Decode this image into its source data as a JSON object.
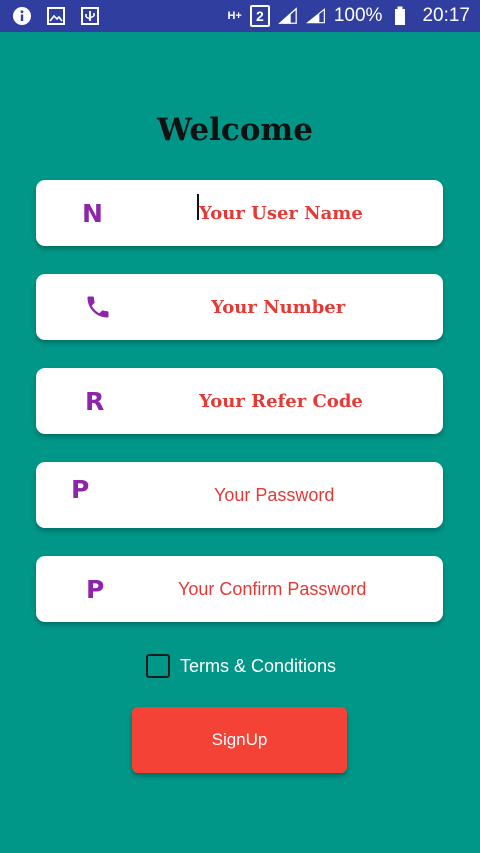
{
  "status_bar": {
    "left_icons": [
      "info-icon",
      "image-icon",
      "usb-icon"
    ],
    "network_type": "H+",
    "sim_slot": "2",
    "signal_icons": [
      "signal-icon",
      "signal-icon"
    ],
    "battery_percent": "100%",
    "battery_icon": "battery-icon",
    "time": "20:17"
  },
  "title": "Welcome",
  "fields": [
    {
      "icon_letter": "N",
      "placeholder": "Your User Name",
      "value": ""
    },
    {
      "icon": "phone-icon",
      "placeholder": "Your Number",
      "value": ""
    },
    {
      "icon_letter": "R",
      "placeholder": "Your Refer Code",
      "value": ""
    },
    {
      "icon_letter": "P",
      "placeholder": "Your Password",
      "value": ""
    },
    {
      "icon_letter": "P",
      "placeholder": "Your Confirm Password",
      "value": ""
    }
  ],
  "terms": {
    "label": "Terms & Conditions",
    "checked": false
  },
  "signup_label": "SignUp",
  "colors": {
    "background": "#009688",
    "status_bar": "#303F9F",
    "icon_purple": "#8E24AA",
    "placeholder_red": "#e53935",
    "signup_button": "#f44336"
  }
}
